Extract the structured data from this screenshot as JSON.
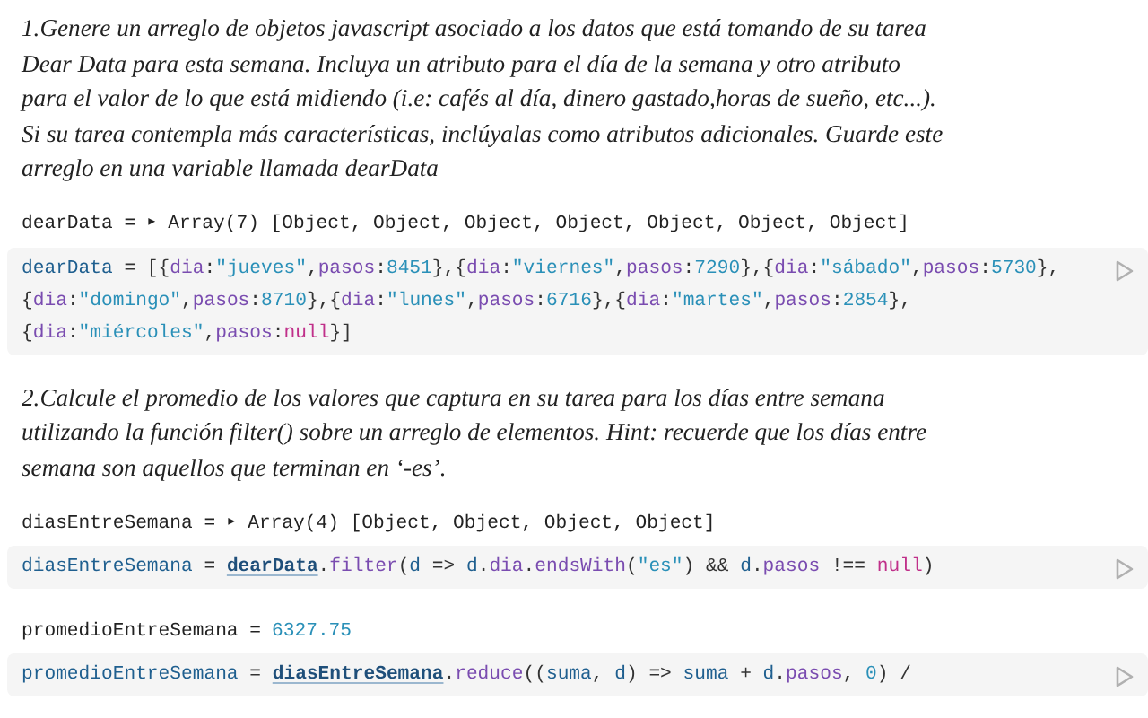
{
  "cells": [
    {
      "kind": "prose",
      "text": "1.Genere un arreglo de objetos javascript asociado a los datos que está tomando de su tarea Dear Data para esta semana. Incluya un atributo para el día de la semana y otro atributo para el valor de lo que está midiendo (i.e: cafés al día, dinero gastado,horas de sueño, etc...). Si su tarea contempla más características, inclúyalas como atributos adicionales. Guarde este arreglo en una variable llamada dearData"
    },
    {
      "kind": "output",
      "name": "dearData =",
      "toggle": "▸",
      "value": {
        "kind": "plain",
        "text": "Array(7) [Object, Object, Object, Object, Object, Object, Object]"
      }
    },
    {
      "kind": "code",
      "lines": [
        [
          {
            "kind": "var",
            "text": "dearData"
          },
          {
            "kind": "punct",
            "text": " = [{"
          },
          {
            "kind": "prop",
            "text": "dia"
          },
          {
            "kind": "punct",
            "text": ":"
          },
          {
            "kind": "string",
            "text": "\"jueves\""
          },
          {
            "kind": "punct",
            "text": ","
          },
          {
            "kind": "prop",
            "text": "pasos"
          },
          {
            "kind": "punct",
            "text": ":"
          },
          {
            "kind": "number",
            "text": "8451"
          },
          {
            "kind": "punct",
            "text": "},{"
          },
          {
            "kind": "prop",
            "text": "dia"
          },
          {
            "kind": "punct",
            "text": ":"
          },
          {
            "kind": "string",
            "text": "\"viernes\""
          },
          {
            "kind": "punct",
            "text": ","
          },
          {
            "kind": "prop",
            "text": "pasos"
          },
          {
            "kind": "punct",
            "text": ":"
          },
          {
            "kind": "number",
            "text": "7290"
          },
          {
            "kind": "punct",
            "text": "},{"
          },
          {
            "kind": "prop",
            "text": "dia"
          },
          {
            "kind": "punct",
            "text": ":"
          },
          {
            "kind": "string",
            "text": "\"sábado\""
          },
          {
            "kind": "punct",
            "text": ","
          },
          {
            "kind": "prop",
            "text": "pasos"
          },
          {
            "kind": "punct",
            "text": ":"
          },
          {
            "kind": "number",
            "text": "5730"
          },
          {
            "kind": "punct",
            "text": "},"
          }
        ],
        [
          {
            "kind": "punct",
            "text": "{"
          },
          {
            "kind": "prop",
            "text": "dia"
          },
          {
            "kind": "punct",
            "text": ":"
          },
          {
            "kind": "string",
            "text": "\"domingo\""
          },
          {
            "kind": "punct",
            "text": ","
          },
          {
            "kind": "prop",
            "text": "pasos"
          },
          {
            "kind": "punct",
            "text": ":"
          },
          {
            "kind": "number",
            "text": "8710"
          },
          {
            "kind": "punct",
            "text": "},{"
          },
          {
            "kind": "prop",
            "text": "dia"
          },
          {
            "kind": "punct",
            "text": ":"
          },
          {
            "kind": "string",
            "text": "\"lunes\""
          },
          {
            "kind": "punct",
            "text": ","
          },
          {
            "kind": "prop",
            "text": "pasos"
          },
          {
            "kind": "punct",
            "text": ":"
          },
          {
            "kind": "number",
            "text": "6716"
          },
          {
            "kind": "punct",
            "text": "},{"
          },
          {
            "kind": "prop",
            "text": "dia"
          },
          {
            "kind": "punct",
            "text": ":"
          },
          {
            "kind": "string",
            "text": "\"martes\""
          },
          {
            "kind": "punct",
            "text": ","
          },
          {
            "kind": "prop",
            "text": "pasos"
          },
          {
            "kind": "punct",
            "text": ":"
          },
          {
            "kind": "number",
            "text": "2854"
          },
          {
            "kind": "punct",
            "text": "},"
          }
        ],
        [
          {
            "kind": "punct",
            "text": "{"
          },
          {
            "kind": "prop",
            "text": "dia"
          },
          {
            "kind": "punct",
            "text": ":"
          },
          {
            "kind": "string",
            "text": "\"miércoles\""
          },
          {
            "kind": "punct",
            "text": ","
          },
          {
            "kind": "prop",
            "text": "pasos"
          },
          {
            "kind": "punct",
            "text": ":"
          },
          {
            "kind": "keyword",
            "text": "null"
          },
          {
            "kind": "punct",
            "text": "}]"
          }
        ]
      ]
    },
    {
      "kind": "prose",
      "text": "2.Calcule el promedio de los valores que captura en su tarea para los días entre semana utilizando la función filter() sobre un arreglo de elementos. Hint: recuerde que los días entre semana son aquellos que terminan en ‘-es’."
    },
    {
      "kind": "output",
      "name": "diasEntreSemana =",
      "toggle": "▸",
      "value": {
        "kind": "plain",
        "text": "Array(4) [Object, Object, Object, Object]"
      }
    },
    {
      "kind": "code",
      "lines": [
        [
          {
            "kind": "var",
            "text": "diasEntreSemana"
          },
          {
            "kind": "punct",
            "text": " = "
          },
          {
            "kind": "ref",
            "text": "dearData"
          },
          {
            "kind": "punct",
            "text": "."
          },
          {
            "kind": "prop",
            "text": "filter"
          },
          {
            "kind": "punct",
            "text": "("
          },
          {
            "kind": "var",
            "text": "d"
          },
          {
            "kind": "punct",
            "text": " => "
          },
          {
            "kind": "var",
            "text": "d"
          },
          {
            "kind": "punct",
            "text": "."
          },
          {
            "kind": "prop",
            "text": "dia"
          },
          {
            "kind": "punct",
            "text": "."
          },
          {
            "kind": "prop",
            "text": "endsWith"
          },
          {
            "kind": "punct",
            "text": "("
          },
          {
            "kind": "string",
            "text": "\"es\""
          },
          {
            "kind": "punct",
            "text": ") && "
          },
          {
            "kind": "var",
            "text": "d"
          },
          {
            "kind": "punct",
            "text": "."
          },
          {
            "kind": "prop",
            "text": "pasos"
          },
          {
            "kind": "punct",
            "text": " !== "
          },
          {
            "kind": "keyword",
            "text": "null"
          },
          {
            "kind": "punct",
            "text": ")"
          }
        ]
      ]
    },
    {
      "kind": "output",
      "name": "promedioEntreSemana =",
      "value": {
        "kind": "number",
        "text": "6327.75"
      }
    },
    {
      "kind": "code",
      "lines": [
        [
          {
            "kind": "var",
            "text": "promedioEntreSemana"
          },
          {
            "kind": "punct",
            "text": " = "
          },
          {
            "kind": "ref",
            "text": "diasEntreSemana"
          },
          {
            "kind": "punct",
            "text": "."
          },
          {
            "kind": "prop",
            "text": "reduce"
          },
          {
            "kind": "punct",
            "text": "(("
          },
          {
            "kind": "var",
            "text": "suma"
          },
          {
            "kind": "punct",
            "text": ", "
          },
          {
            "kind": "var",
            "text": "d"
          },
          {
            "kind": "punct",
            "text": ") => "
          },
          {
            "kind": "var",
            "text": "suma"
          },
          {
            "kind": "punct",
            "text": " + "
          },
          {
            "kind": "var",
            "text": "d"
          },
          {
            "kind": "punct",
            "text": "."
          },
          {
            "kind": "prop",
            "text": "pasos"
          },
          {
            "kind": "punct",
            "text": ", "
          },
          {
            "kind": "number",
            "text": "0"
          },
          {
            "kind": "punct",
            "text": ") /"
          }
        ]
      ]
    }
  ]
}
